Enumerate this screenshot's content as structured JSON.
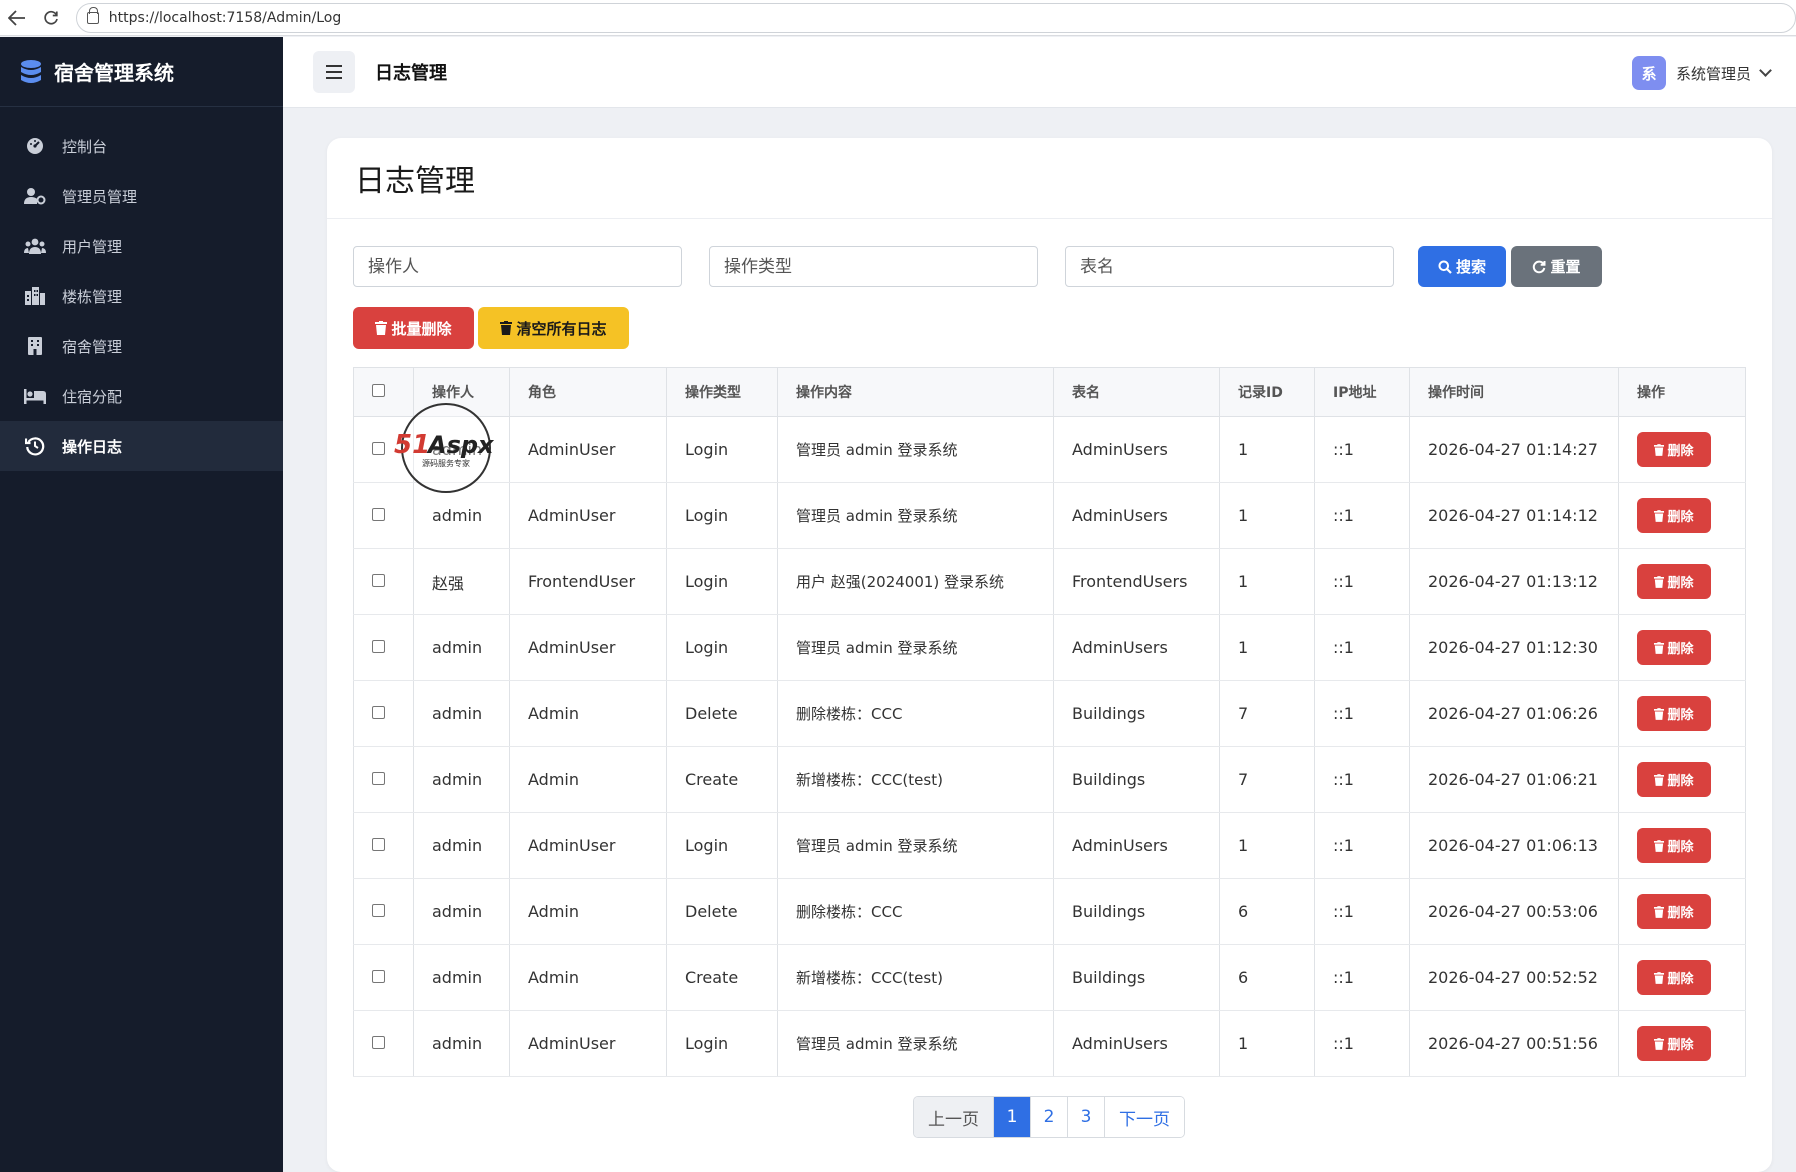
{
  "browser": {
    "url": "https://localhost:7158/Admin/Log",
    "icons": [
      "back-arrow-icon",
      "reload-icon",
      "lock-icon"
    ]
  },
  "sidebar": {
    "brand": "宿舍管理系统",
    "brand_icon": "database-icon",
    "items": [
      {
        "label": "控制台",
        "icon": "dashboard-icon"
      },
      {
        "label": "管理员管理",
        "icon": "user-cog-icon"
      },
      {
        "label": "用户管理",
        "icon": "users-icon"
      },
      {
        "label": "楼栋管理",
        "icon": "city-icon"
      },
      {
        "label": "宿舍管理",
        "icon": "building-icon"
      },
      {
        "label": "住宿分配",
        "icon": "bed-icon"
      },
      {
        "label": "操作日志",
        "icon": "history-icon",
        "active": true
      }
    ]
  },
  "header": {
    "menu_icon": "hamburger-icon",
    "title": "日志管理",
    "avatar_text": "系",
    "user_name": "系统管理员"
  },
  "main": {
    "title": "日志管理",
    "filters": {
      "operator_placeholder": "操作人",
      "type_placeholder": "操作类型",
      "table_placeholder": "表名"
    },
    "search_label": "搜索",
    "reset_label": "重置",
    "batch_delete_label": "批量删除",
    "clear_all_label": "清空所有日志",
    "columns": [
      "",
      "操作人",
      "角色",
      "操作类型",
      "操作内容",
      "表名",
      "记录ID",
      "IP地址",
      "操作时间",
      "操作"
    ],
    "delete_label": "删除",
    "rows": [
      {
        "operator": "admin",
        "role": "AdminUser",
        "type": "Login",
        "content": "管理员 admin 登录系统",
        "table": "AdminUsers",
        "record_id": "1",
        "ip": "::1",
        "time": "2026-04-27 01:14:27"
      },
      {
        "operator": "admin",
        "role": "AdminUser",
        "type": "Login",
        "content": "管理员 admin 登录系统",
        "table": "AdminUsers",
        "record_id": "1",
        "ip": "::1",
        "time": "2026-04-27 01:14:12"
      },
      {
        "operator": "赵强",
        "role": "FrontendUser",
        "type": "Login",
        "content": "用户 赵强(2024001) 登录系统",
        "table": "FrontendUsers",
        "record_id": "1",
        "ip": "::1",
        "time": "2026-04-27 01:13:12"
      },
      {
        "operator": "admin",
        "role": "AdminUser",
        "type": "Login",
        "content": "管理员 admin 登录系统",
        "table": "AdminUsers",
        "record_id": "1",
        "ip": "::1",
        "time": "2026-04-27 01:12:30"
      },
      {
        "operator": "admin",
        "role": "Admin",
        "type": "Delete",
        "content": "删除楼栋：CCC",
        "table": "Buildings",
        "record_id": "7",
        "ip": "::1",
        "time": "2026-04-27 01:06:26"
      },
      {
        "operator": "admin",
        "role": "Admin",
        "type": "Create",
        "content": "新增楼栋：CCC(test)",
        "table": "Buildings",
        "record_id": "7",
        "ip": "::1",
        "time": "2026-04-27 01:06:21"
      },
      {
        "operator": "admin",
        "role": "AdminUser",
        "type": "Login",
        "content": "管理员 admin 登录系统",
        "table": "AdminUsers",
        "record_id": "1",
        "ip": "::1",
        "time": "2026-04-27 01:06:13"
      },
      {
        "operator": "admin",
        "role": "Admin",
        "type": "Delete",
        "content": "删除楼栋：CCC",
        "table": "Buildings",
        "record_id": "6",
        "ip": "::1",
        "time": "2026-04-27 00:53:06"
      },
      {
        "operator": "admin",
        "role": "Admin",
        "type": "Create",
        "content": "新增楼栋：CCC(test)",
        "table": "Buildings",
        "record_id": "6",
        "ip": "::1",
        "time": "2026-04-27 00:52:52"
      },
      {
        "operator": "admin",
        "role": "AdminUser",
        "type": "Login",
        "content": "管理员 admin 登录系统",
        "table": "AdminUsers",
        "record_id": "1",
        "ip": "::1",
        "time": "2026-04-27 00:51:56"
      }
    ],
    "pagination": {
      "prev": "上一页",
      "pages": [
        "1",
        "2",
        "3"
      ],
      "current": "1",
      "next": "下一页"
    },
    "watermark": {
      "brand": "51Aspx",
      "tagline": "源码服务专家"
    }
  },
  "colors": {
    "sidebar_bg": "#151c2b",
    "primary": "#2f6fe4",
    "danger": "#d9413e",
    "warning": "#f5c225",
    "secondary": "#6a727b"
  }
}
